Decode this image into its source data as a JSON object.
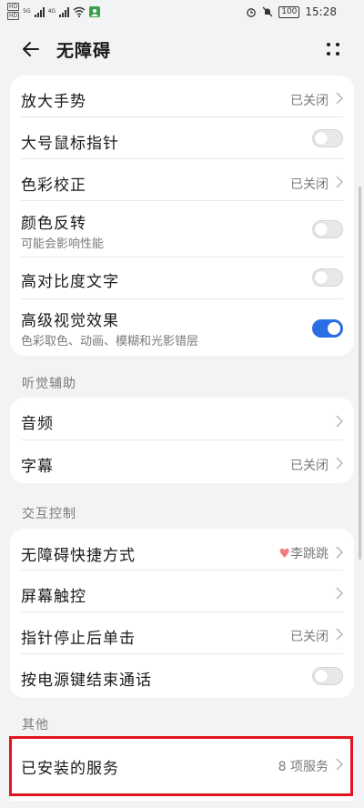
{
  "status_bar": {
    "left_badges": [
      "HD",
      "HD"
    ],
    "signal_labels": [
      "5G",
      "4G"
    ],
    "time": "15:28",
    "battery": "100"
  },
  "header": {
    "title": "无障碍"
  },
  "group1": {
    "rows": [
      {
        "label": "放大手势",
        "value": "已关闭"
      },
      {
        "label": "大号鼠标指针"
      },
      {
        "label": "色彩校正",
        "value": "已关闭"
      },
      {
        "label": "颜色反转",
        "subtitle": "可能会影响性能"
      },
      {
        "label": "高对比度文字"
      },
      {
        "label": "高级视觉效果",
        "subtitle": "色彩取色、动画、模糊和光影错层"
      }
    ]
  },
  "section_hearing": {
    "title": "听觉辅助"
  },
  "group2": {
    "rows": [
      {
        "label": "音频"
      },
      {
        "label": "字幕",
        "value": "已关闭"
      }
    ]
  },
  "section_interaction": {
    "title": "交互控制"
  },
  "group3": {
    "rows": [
      {
        "label": "无障碍快捷方式",
        "value": "李跳跳"
      },
      {
        "label": "屏幕触控"
      },
      {
        "label": "指针停止后单击",
        "value": "已关闭"
      },
      {
        "label": "按电源键结束通话"
      }
    ]
  },
  "section_other": {
    "title": "其他"
  },
  "group4": {
    "rows": [
      {
        "label": "已安装的服务",
        "value": "8 项服务"
      }
    ]
  },
  "toggles": {
    "large_pointer": false,
    "color_inversion": false,
    "high_contrast_text": false,
    "advanced_visual_effects": true,
    "power_button_ends_call": false
  },
  "colors": {
    "accent": "#2a6ee6",
    "highlight_border": "#e0151f",
    "background": "#f1f3f5"
  }
}
